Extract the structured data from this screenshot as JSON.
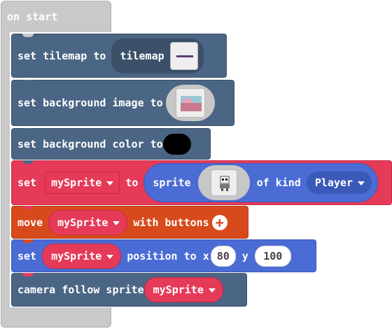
{
  "on_start": {
    "label": "on start"
  },
  "blocks": {
    "set_tilemap": {
      "label": "set tilemap to",
      "value": "tilemap"
    },
    "set_bg_image": {
      "label": "set background image to"
    },
    "set_bg_color": {
      "label": "set background color to",
      "color": "#000000"
    },
    "set_sprite": {
      "set_label": "set",
      "variable": "mySprite",
      "to_label": "to",
      "sprite_label": "sprite",
      "of_kind_label": "of kind",
      "kind": "Player"
    },
    "move": {
      "label": "move",
      "variable": "mySprite",
      "with_buttons": "with buttons"
    },
    "position": {
      "set_label": "set",
      "variable": "mySprite",
      "position_label": "position to x",
      "x": "80",
      "y_label": "y",
      "y": "100"
    },
    "camera": {
      "label": "camera follow sprite",
      "variable": "mySprite"
    }
  },
  "colors": {
    "scene": "#4b6584",
    "sprite": "#e63a59",
    "controller": "#d74a1c",
    "movement": "#4a6cd4",
    "hat": "#c9c9c9"
  },
  "icons": {
    "dropdown": "chevron-down-icon",
    "add": "plus-circle-icon"
  }
}
